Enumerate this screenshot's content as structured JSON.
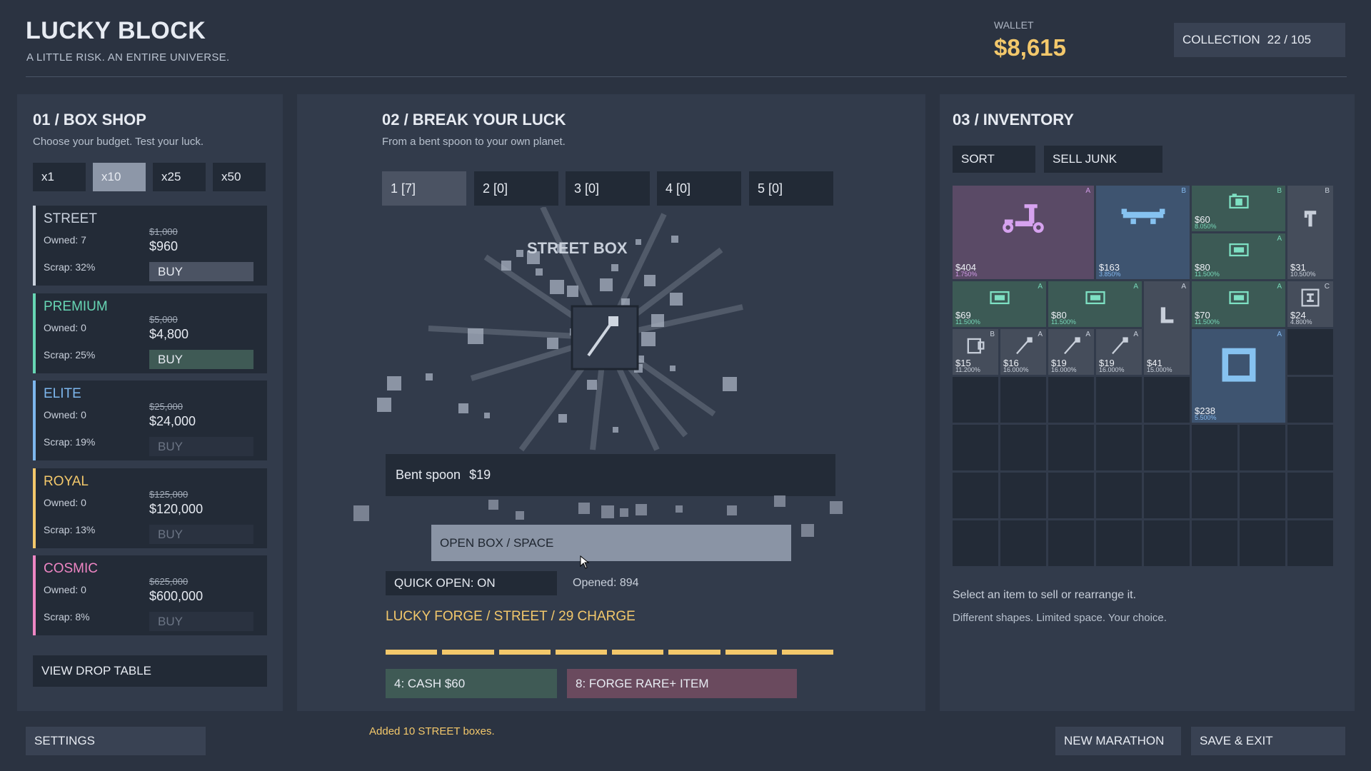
{
  "header": {
    "title": "LUCKY BLOCK",
    "subtitle": "A LITTLE RISK. AN ENTIRE UNIVERSE.",
    "wallet_label": "WALLET",
    "wallet_value": "$8,615",
    "collection_label": "COLLECTION",
    "collection_value": "22 / 105"
  },
  "shop": {
    "title": "01 / BOX SHOP",
    "subtitle": "Choose your budget. Test your luck.",
    "multipliers": [
      "x1",
      "x10",
      "x25",
      "x50"
    ],
    "selected_multiplier": "x10",
    "boxes": [
      {
        "name": "STREET",
        "owned": "Owned: 7",
        "old_price": "$1,000",
        "price": "$960",
        "scrap": "Scrap: 32%",
        "buy": "BUY",
        "color": "#c9d1dd",
        "affordable": true
      },
      {
        "name": "PREMIUM",
        "owned": "Owned: 0",
        "old_price": "$5,000",
        "price": "$4,800",
        "scrap": "Scrap: 25%",
        "buy": "BUY",
        "color": "#67d6b4",
        "affordable": true
      },
      {
        "name": "ELITE",
        "owned": "Owned: 0",
        "old_price": "$25,000",
        "price": "$24,000",
        "scrap": "Scrap: 19%",
        "buy": "BUY",
        "color": "#7db7ee",
        "affordable": false
      },
      {
        "name": "ROYAL",
        "owned": "Owned: 0",
        "old_price": "$125,000",
        "price": "$120,000",
        "scrap": "Scrap: 13%",
        "buy": "BUY",
        "color": "#f3c86b",
        "affordable": false
      },
      {
        "name": "COSMIC",
        "owned": "Owned: 0",
        "old_price": "$625,000",
        "price": "$600,000",
        "scrap": "Scrap: 8%",
        "buy": "BUY",
        "color": "#ee86c4",
        "affordable": false
      }
    ],
    "drop_table": "VIEW DROP TABLE"
  },
  "break": {
    "title": "02 / BREAK YOUR LUCK",
    "subtitle": "From a bent spoon to your own planet.",
    "slots": [
      "1  [7]",
      "2  [0]",
      "3  [0]",
      "4  [0]",
      "5  [0]"
    ],
    "box_name": "STREET BOX",
    "result_name": "Bent spoon",
    "result_price": "$19",
    "open_button": "OPEN BOX  /  SPACE",
    "quick_open": "QUICK OPEN: ON",
    "opened": "Opened: 894",
    "forge": "LUCKY FORGE / STREET / 29 CHARGE",
    "forge_segments_filled": 8,
    "cash_button": "4: CASH $60",
    "forge_button": "8: FORGE RARE+ ITEM",
    "status": "Added 10 STREET boxes."
  },
  "inventory": {
    "title": "03 / INVENTORY",
    "sort": "SORT",
    "sell_junk": "SELL JUNK",
    "items": [
      {
        "icon": "scooter-icon",
        "price": "$404",
        "pct": "1.750%",
        "rank": "A",
        "tone": "purple"
      },
      {
        "icon": "skateboard-icon",
        "price": "$163",
        "pct": "3.850%",
        "rank": "B",
        "tone": "blue"
      },
      {
        "icon": "camera-icon",
        "price": "$60",
        "pct": "8.050%",
        "rank": "B",
        "tone": "green"
      },
      {
        "icon": "tool-icon",
        "price": "$31",
        "pct": "10.500%",
        "rank": "B",
        "tone": "gray"
      },
      {
        "icon": "card-icon",
        "price": "$80",
        "pct": "11.500%",
        "rank": "A",
        "tone": "green"
      },
      {
        "icon": "card-icon",
        "price": "$69",
        "pct": "11.500%",
        "rank": "A",
        "tone": "green"
      },
      {
        "icon": "card-icon",
        "price": "$80",
        "pct": "11.500%",
        "rank": "A",
        "tone": "green"
      },
      {
        "icon": "bracket-icon",
        "price": "$41",
        "pct": "15.000%",
        "rank": "A",
        "tone": "gray"
      },
      {
        "icon": "card-icon",
        "price": "$70",
        "pct": "11.500%",
        "rank": "A",
        "tone": "green"
      },
      {
        "icon": "frame-icon",
        "price": "$24",
        "pct": "4.800%",
        "rank": "C",
        "tone": "gray"
      },
      {
        "icon": "cup-icon",
        "price": "$15",
        "pct": "11.200%",
        "rank": "B",
        "tone": "gray"
      },
      {
        "icon": "spoon-icon",
        "price": "$16",
        "pct": "16.000%",
        "rank": "A",
        "tone": "gray"
      },
      {
        "icon": "spoon-icon",
        "price": "$19",
        "pct": "16.000%",
        "rank": "A",
        "tone": "gray"
      },
      {
        "icon": "spoon-icon",
        "price": "$19",
        "pct": "16.000%",
        "rank": "A",
        "tone": "gray"
      },
      {
        "icon": "square-icon",
        "price": "$238",
        "pct": "5.500%",
        "rank": "A",
        "tone": "blue"
      }
    ],
    "hint1": "Select an item to sell or rearrange it.",
    "hint2": "Different shapes. Limited space. Your choice."
  },
  "footer": {
    "settings": "SETTINGS",
    "new_marathon": "NEW MARATHON",
    "save_exit": "SAVE & EXIT"
  }
}
